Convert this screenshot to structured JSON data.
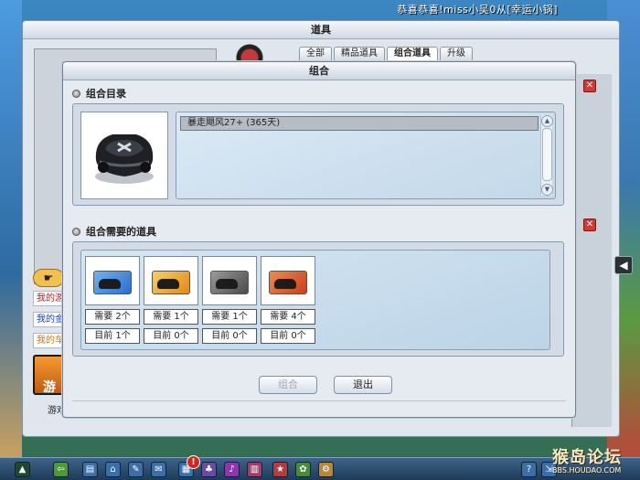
{
  "top_message": "恭喜恭喜!miss小吴0从[幸运小锅]",
  "outer_window": {
    "title": "道具",
    "tabs": [
      {
        "label": "全部",
        "active": false
      },
      {
        "label": "精品道具",
        "active": false
      },
      {
        "label": "组合道具",
        "active": true
      },
      {
        "label": "升级",
        "active": false
      }
    ],
    "left_links": [
      "我的游",
      "我的金",
      "我的车"
    ],
    "game_button_label": "游",
    "game_button_caption": "游戏"
  },
  "dialog": {
    "title": "组合",
    "catalog_section": {
      "heading": "组合目录",
      "selected_item": "暴走飓风27+ (365天)"
    },
    "required_section": {
      "heading": "组合需要的道具",
      "items": [
        {
          "need": "需要 2个",
          "have": "目前 1个",
          "card_color": "#2a6fd0"
        },
        {
          "need": "需要 1个",
          "have": "目前 0个",
          "card_color": "#e08a1a"
        },
        {
          "need": "需要 1个",
          "have": "目前 0个",
          "card_color": "#4a4a4a"
        },
        {
          "need": "需要 4个",
          "have": "目前 0个",
          "card_color": "#c8401e"
        }
      ]
    },
    "combine_button": "组合",
    "exit_button": "退出"
  },
  "watermark": {
    "main": "猴岛论坛",
    "sub": "BBS.HOUDAO.COM"
  }
}
